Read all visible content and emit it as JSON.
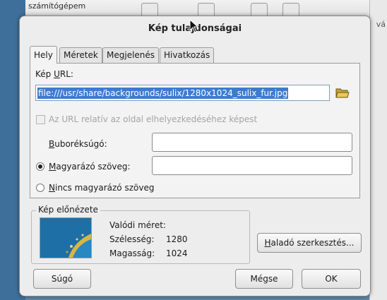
{
  "background": {
    "app_title": "számítógépem",
    "side_text": "vá"
  },
  "dialog": {
    "title": "Kép tulajdonságai"
  },
  "tabs": [
    {
      "label": "Hely"
    },
    {
      "label": "Méretek"
    },
    {
      "label": "Megjelenés"
    },
    {
      "label": "Hivatkozás"
    }
  ],
  "location": {
    "url_label_prefix": "Kép ",
    "url_label_underlined": "U",
    "url_label_suffix": "RL:",
    "url_value": "file:///usr/share/backgrounds/sulix/1280x1024_sulix_fur.jpg",
    "relative_checkbox_label": "Az URL relatív az oldal elhelyezkedéséhez képest",
    "tooltip_label": "Buboréksúgó:",
    "tooltip_value": "",
    "alt_text_label": "Magyarázó szöveg:",
    "alt_text_value": "",
    "no_alt_text_label": "Nincs magyarázó szöveg"
  },
  "preview": {
    "legend": "Kép előnézete",
    "actual_size_label": "Valódi méret:",
    "width_label": "Szélesség:",
    "width_value": "1280",
    "height_label": "Magasság:",
    "height_value": "1024"
  },
  "buttons": {
    "advanced_edit": "Haladó szerkesztés...",
    "help": "Súgó",
    "cancel": "Mégse",
    "ok": "OK"
  },
  "colors": {
    "selection": "#3d7bd1",
    "dialog_bg": "#ededed"
  }
}
